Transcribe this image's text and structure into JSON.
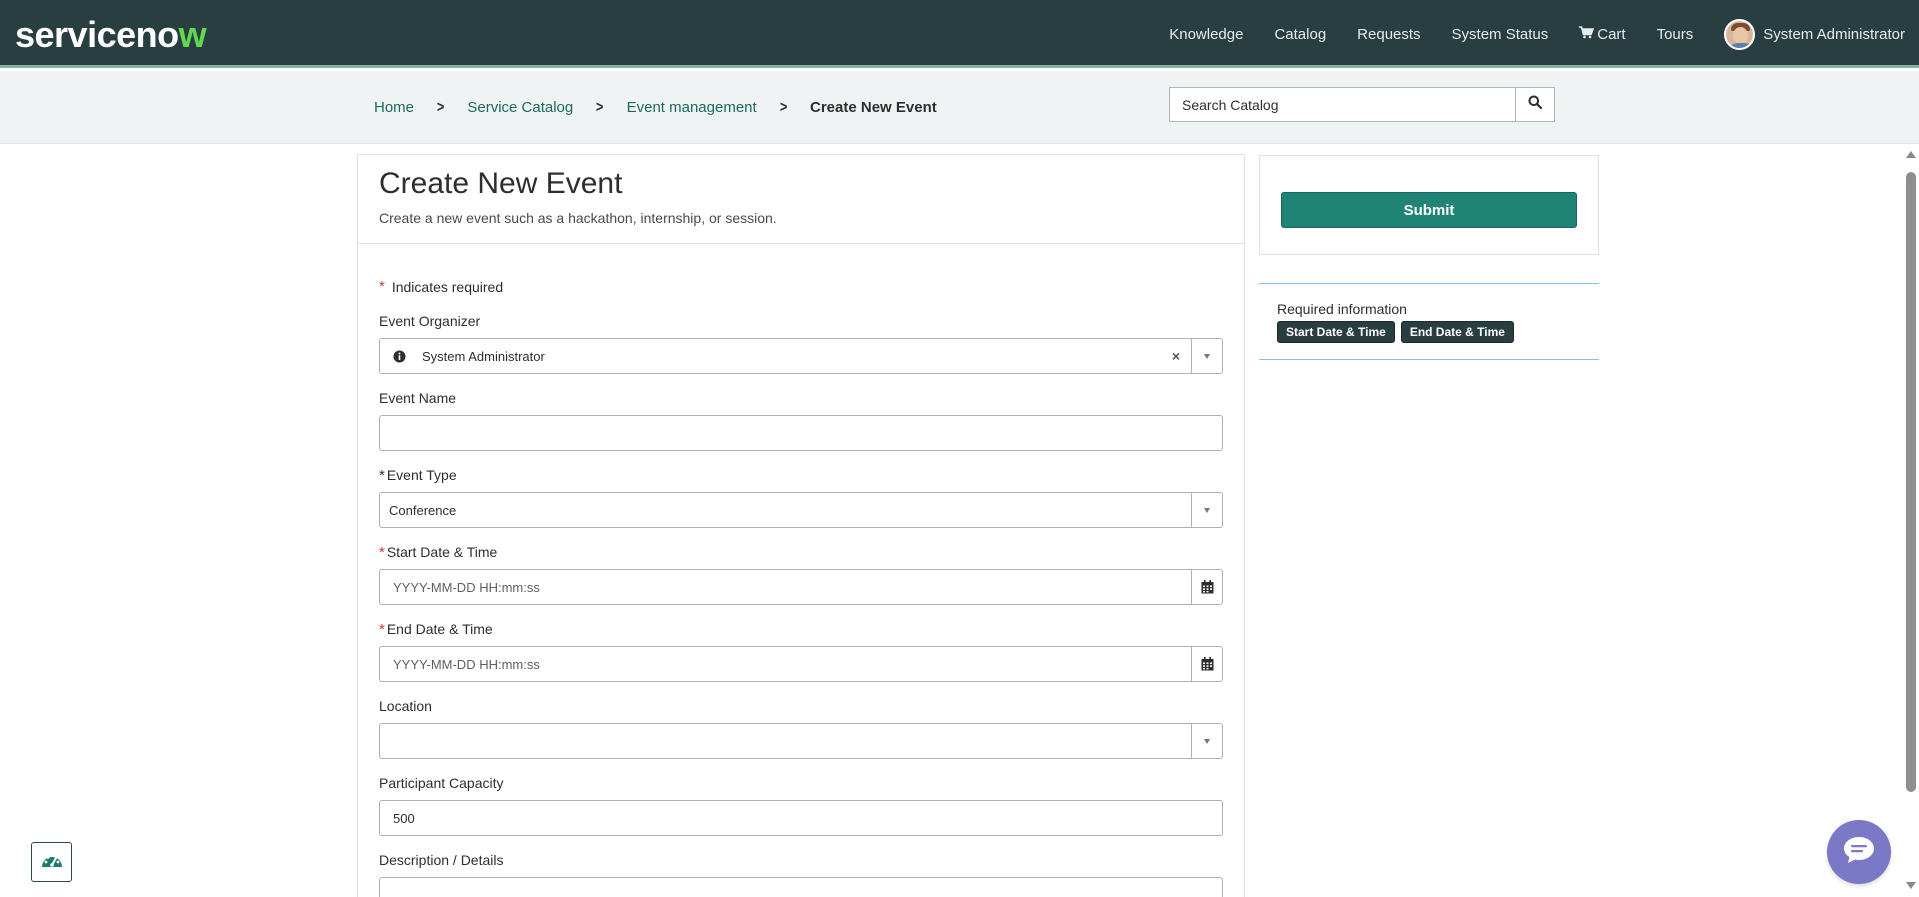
{
  "header": {
    "logo_text": "servicenow",
    "nav": [
      "Knowledge",
      "Catalog",
      "Requests",
      "System Status",
      "Cart",
      "Tours"
    ],
    "user_name": "System Administrator",
    "colors": {
      "bar": "#293e40",
      "accent": "#62d84e"
    }
  },
  "breadcrumb": {
    "items": [
      "Home",
      "Service Catalog",
      "Event management"
    ],
    "current": "Create New Event"
  },
  "search": {
    "placeholder": "Search Catalog",
    "icon": "search-icon"
  },
  "form": {
    "title": "Create New Event",
    "subtitle": "Create a new event such as a hackathon, internship, or session.",
    "required_note": "Indicates required",
    "fields": {
      "organizer": {
        "label": "Event Organizer",
        "value": "System Administrator",
        "icons": [
          "info-icon",
          "clear-icon",
          "chevron-down-icon"
        ]
      },
      "name": {
        "label": "Event Name",
        "value": ""
      },
      "type": {
        "label": "Event Type",
        "value": "Conference"
      },
      "start": {
        "label": "Start Date & Time",
        "placeholder": "YYYY-MM-DD HH:mm:ss",
        "icon": "calendar-icon"
      },
      "end": {
        "label": "End Date & Time",
        "placeholder": "YYYY-MM-DD HH:mm:ss",
        "icon": "calendar-icon"
      },
      "location": {
        "label": "Location",
        "value": ""
      },
      "capacity": {
        "label": "Participant Capacity",
        "value": "500"
      },
      "description": {
        "label": "Description / Details",
        "value": ""
      }
    }
  },
  "sidebar": {
    "submit_label": "Submit",
    "required_title": "Required information",
    "required_badges": [
      "Start Date & Time",
      "End Date & Time"
    ],
    "colors": {
      "submit": "#1f8476"
    }
  }
}
